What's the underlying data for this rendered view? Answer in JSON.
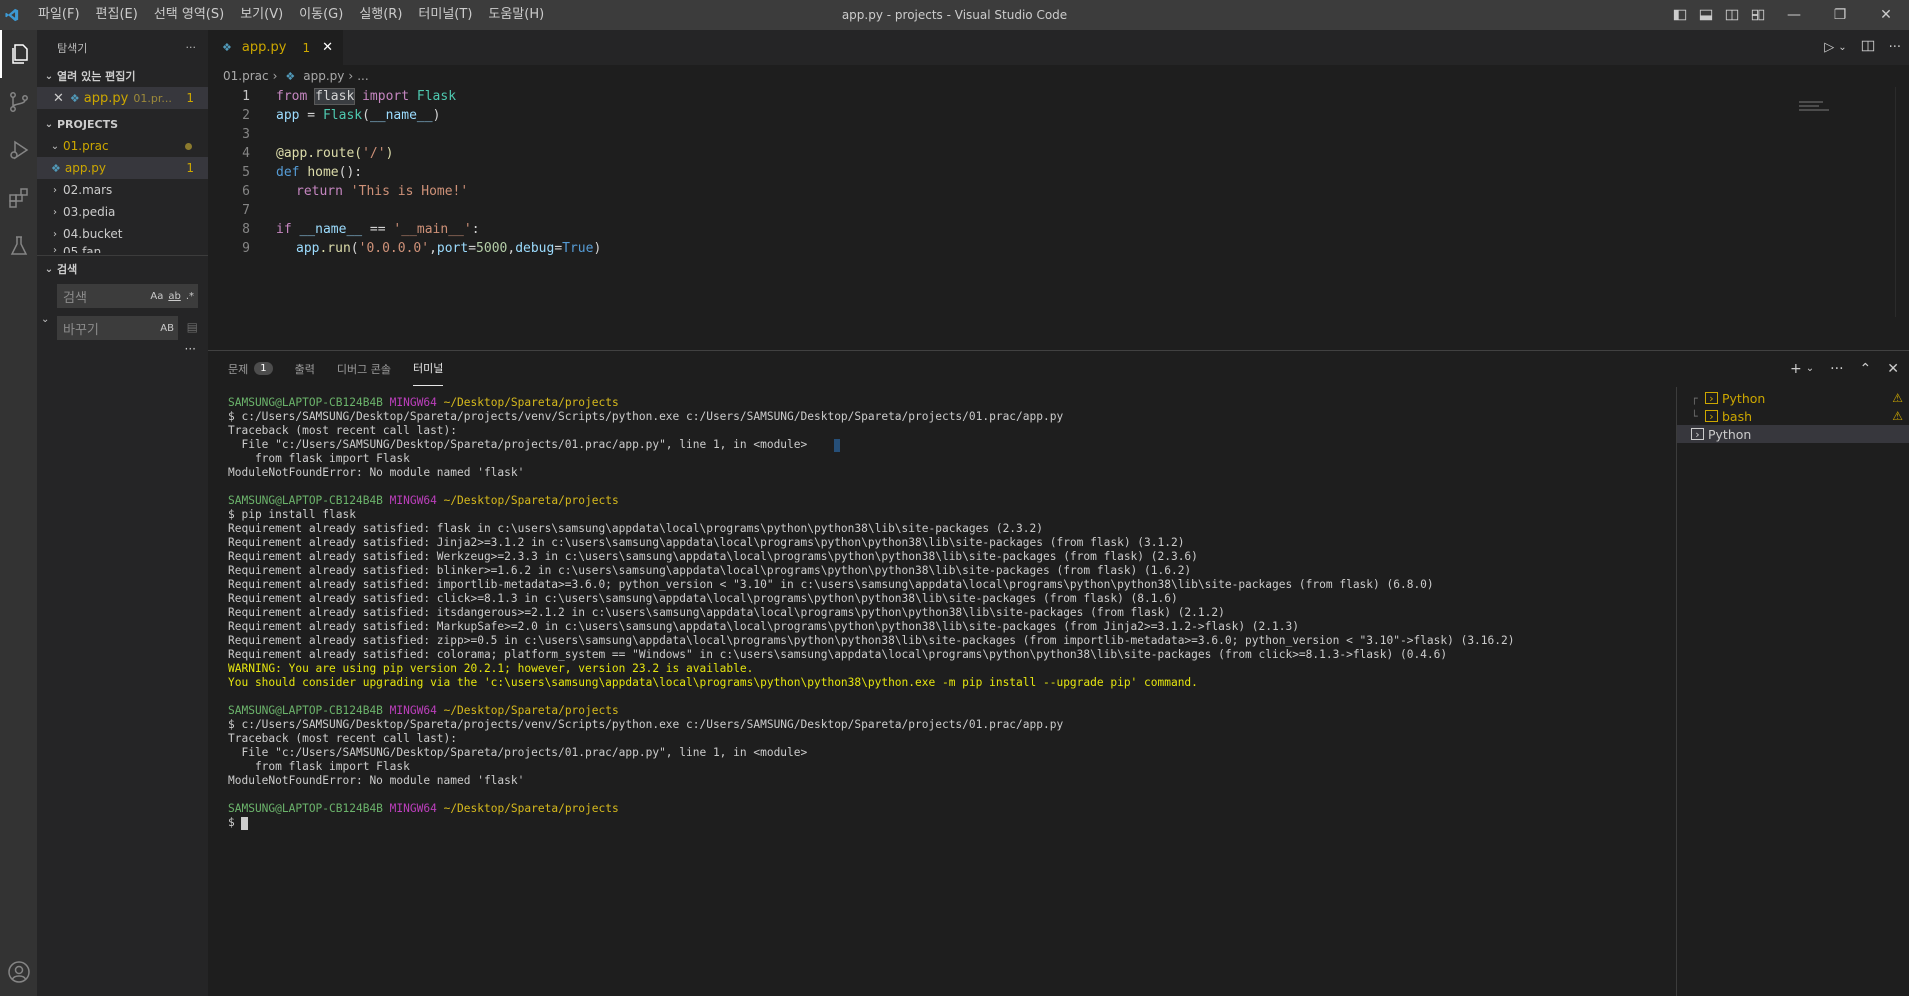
{
  "titlebar": {
    "menu": [
      "파일(F)",
      "편집(E)",
      "선택 영역(S)",
      "보기(V)",
      "이동(G)",
      "실행(R)",
      "터미널(T)",
      "도움말(H)"
    ],
    "title": "app.py - projects - Visual Studio Code"
  },
  "sidebar": {
    "header": "탐색기",
    "more": "···",
    "open_editors": {
      "title": "열려 있는 편집기",
      "item_name": "app.py",
      "item_dir": "01.pr...",
      "item_badge": "1"
    },
    "projects": {
      "title": "PROJECTS",
      "folders": [
        {
          "name": "01.prac",
          "expanded": true
        },
        {
          "name": "app.py",
          "badge": "1",
          "file": true
        },
        {
          "name": "02.mars"
        },
        {
          "name": "03.pedia"
        },
        {
          "name": "04.bucket"
        },
        {
          "name": "05.fan"
        }
      ]
    },
    "search": {
      "title": "검색",
      "search_placeholder": "검색",
      "replace_placeholder": "바꾸기",
      "opt_case": "Aa",
      "opt_word": "ab",
      "opt_regex": ".*",
      "opt_preserve": "AB",
      "more": "···"
    }
  },
  "editor": {
    "tab": {
      "name": "app.py",
      "badge": "1"
    },
    "breadcrumb": [
      "01.prac",
      "app.py",
      "..."
    ],
    "lines": [
      {
        "n": "1"
      },
      {
        "n": "2"
      },
      {
        "n": "3"
      },
      {
        "n": "4"
      },
      {
        "n": "5"
      },
      {
        "n": "6"
      },
      {
        "n": "7"
      },
      {
        "n": "8"
      },
      {
        "n": "9"
      }
    ],
    "code": {
      "l1_from": "from",
      "l1_mod": "flask",
      "l1_import": "import",
      "l1_cls": "Flask",
      "l2_app": "app",
      "l2_eq": " = ",
      "l2_cls": "Flask",
      "l2_rest": "(",
      "l2_name": "__name__",
      "l2_end": ")",
      "l4_dec": "@app.route(",
      "l4_str": "'/'",
      "l4_end": ")",
      "l5_def": "def",
      "l5_fn": "home",
      "l5_end": "():",
      "l6_ret": "return",
      "l6_str": "'This is Home!'",
      "l8_if": "if",
      "l8_name": "__name__",
      "l8_eq": " == ",
      "l8_str": "'__main__'",
      "l8_end": ":",
      "l9_app": "app",
      "l9_run": ".run",
      "l9_open": "(",
      "l9_host": "'0.0.0.0'",
      "l9_c1": ",",
      "l9_port": "port",
      "l9_eq1": "=",
      "l9_pnum": "5000",
      "l9_c2": ",",
      "l9_debug": "debug",
      "l9_eq2": "=",
      "l9_true": "True",
      "l9_close": ")"
    }
  },
  "panel": {
    "tabs": [
      {
        "label": "문제",
        "count": "1"
      },
      {
        "label": "출력"
      },
      {
        "label": "디버그 콘솔"
      },
      {
        "label": "터미널",
        "active": true
      }
    ],
    "terminal": {
      "prompt_user": "SAMSUNG@LAPTOP-CB124B4B",
      "prompt_env": "MINGW64",
      "prompt_path": "~/Desktop/Spareta/projects",
      "cmd_run": "$ c:/Users/SAMSUNG/Desktop/Spareta/projects/venv/Scripts/python.exe c:/Users/SAMSUNG/Desktop/Spareta/projects/01.prac/app.py",
      "tb1": "Traceback (most recent call last):",
      "tb2": "  File \"c:/Users/SAMSUNG/Desktop/Spareta/projects/01.prac/app.py\", line 1, in <module>",
      "tb3": "    from flask import Flask",
      "tb4": "ModuleNotFoundError: No module named 'flask'",
      "cmd_pip": "$ pip install flask",
      "req": [
        "Requirement already satisfied: flask in c:\\users\\samsung\\appdata\\local\\programs\\python\\python38\\lib\\site-packages (2.3.2)",
        "Requirement already satisfied: Jinja2>=3.1.2 in c:\\users\\samsung\\appdata\\local\\programs\\python\\python38\\lib\\site-packages (from flask) (3.1.2)",
        "Requirement already satisfied: Werkzeug>=2.3.3 in c:\\users\\samsung\\appdata\\local\\programs\\python\\python38\\lib\\site-packages (from flask) (2.3.6)",
        "Requirement already satisfied: blinker>=1.6.2 in c:\\users\\samsung\\appdata\\local\\programs\\python\\python38\\lib\\site-packages (from flask) (1.6.2)",
        "Requirement already satisfied: importlib-metadata>=3.6.0; python_version < \"3.10\" in c:\\users\\samsung\\appdata\\local\\programs\\python\\python38\\lib\\site-packages (from flask) (6.8.0)",
        "Requirement already satisfied: click>=8.1.3 in c:\\users\\samsung\\appdata\\local\\programs\\python\\python38\\lib\\site-packages (from flask) (8.1.6)",
        "Requirement already satisfied: itsdangerous>=2.1.2 in c:\\users\\samsung\\appdata\\local\\programs\\python\\python38\\lib\\site-packages (from flask) (2.1.2)",
        "Requirement already satisfied: MarkupSafe>=2.0 in c:\\users\\samsung\\appdata\\local\\programs\\python\\python38\\lib\\site-packages (from Jinja2>=3.1.2->flask) (2.1.3)",
        "Requirement already satisfied: zipp>=0.5 in c:\\users\\samsung\\appdata\\local\\programs\\python\\python38\\lib\\site-packages (from importlib-metadata>=3.6.0; python_version < \"3.10\"->flask) (3.16.2)",
        "Requirement already satisfied: colorama; platform_system == \"Windows\" in c:\\users\\samsung\\appdata\\local\\programs\\python\\python38\\lib\\site-packages (from click>=8.1.3->flask) (0.4.6)"
      ],
      "warn1": "WARNING: You are using pip version 20.2.1; however, version 23.2 is available.",
      "warn2": "You should consider upgrading via the 'c:\\users\\samsung\\appdata\\local\\programs\\python\\python38\\python.exe -m pip install --upgrade pip' command.",
      "final_prompt": "$ "
    },
    "terminal_list": [
      {
        "name": "Python",
        "warn": true
      },
      {
        "name": "bash",
        "warn": true
      },
      {
        "name": "Python",
        "selected": true
      }
    ]
  }
}
